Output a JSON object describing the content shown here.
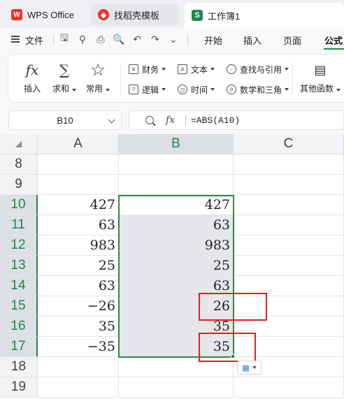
{
  "tabs": {
    "wps": "WPS Office",
    "templates": "找稻壳模板",
    "workbook": "工作簿1",
    "wps_logo": "W",
    "workbook_logo": "S"
  },
  "menu": {
    "file": "文件",
    "tabs": [
      "开始",
      "插入",
      "页面",
      "公式"
    ],
    "active_tab": "公式"
  },
  "ribbon": {
    "big_buttons": [
      {
        "label": "插入",
        "icon": "fx-icon",
        "glyph": "fx"
      },
      {
        "label": "求和",
        "icon": "sigma-icon",
        "glyph": "∑"
      },
      {
        "label": "常用",
        "icon": "star-icon",
        "glyph": "☆"
      }
    ],
    "small_buttons": [
      {
        "label": "财务",
        "icon": "finance-icon"
      },
      {
        "label": "文本",
        "icon": "text-icon"
      },
      {
        "label": "查找与引用",
        "icon": "lookup-icon"
      },
      {
        "label": "逻辑",
        "icon": "logic-icon"
      },
      {
        "label": "时间",
        "icon": "clock-icon"
      },
      {
        "label": "数学和三角",
        "icon": "math-icon"
      }
    ],
    "more_functions": "其他函数"
  },
  "formula_bar": {
    "cell_ref": "B10",
    "fx_label": "fx",
    "formula": "=ABS(A10)"
  },
  "grid": {
    "columns": [
      "A",
      "B",
      "C"
    ],
    "selected_column": "B",
    "rows": [
      {
        "num": "8",
        "a": "",
        "b": ""
      },
      {
        "num": "9",
        "a": "",
        "b": ""
      },
      {
        "num": "10",
        "a": "427",
        "b": "427"
      },
      {
        "num": "11",
        "a": "63",
        "b": "63"
      },
      {
        "num": "12",
        "a": "983",
        "b": "983"
      },
      {
        "num": "13",
        "a": "25",
        "b": "25"
      },
      {
        "num": "14",
        "a": "63",
        "b": "63"
      },
      {
        "num": "15",
        "a": "−26",
        "b": "26"
      },
      {
        "num": "16",
        "a": "35",
        "b": "35"
      },
      {
        "num": "17",
        "a": "−35",
        "b": "35"
      },
      {
        "num": "18",
        "a": "",
        "b": ""
      },
      {
        "num": "19",
        "a": "",
        "b": ""
      }
    ],
    "selected_rows": [
      "10",
      "11",
      "12",
      "13",
      "14",
      "15",
      "16",
      "17"
    ]
  },
  "colors": {
    "accent_green": "#1e8a4c",
    "selection_border": "#2f8a3c",
    "highlight_red": "#e02020"
  }
}
